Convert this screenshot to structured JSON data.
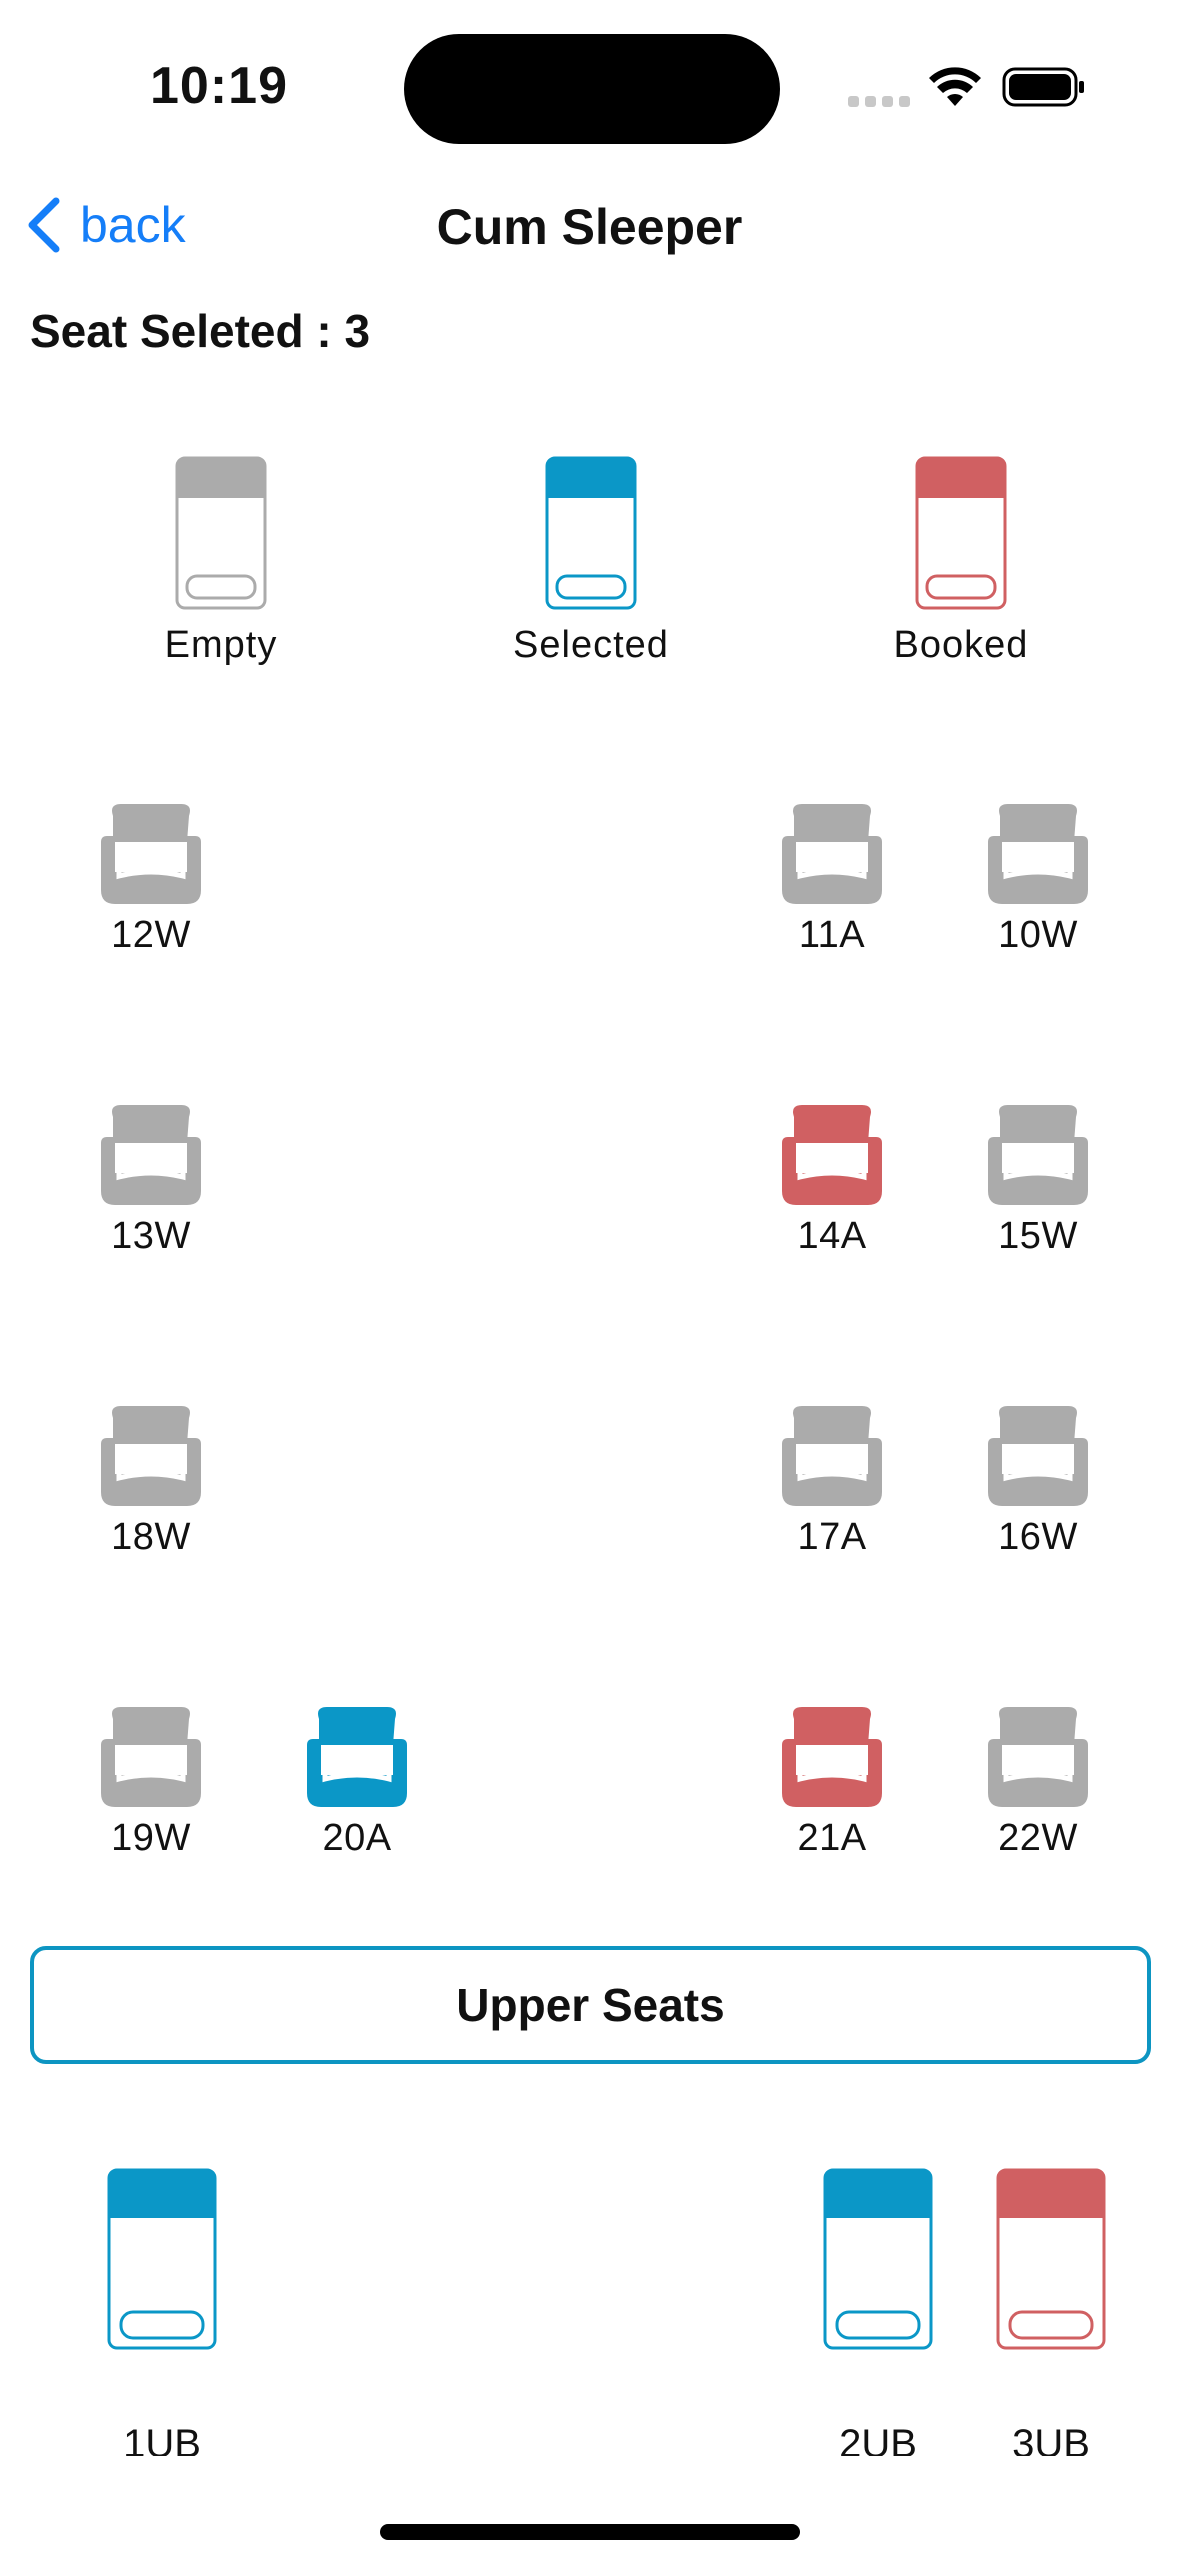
{
  "status": {
    "time": "10:19"
  },
  "nav": {
    "back_label": "back",
    "title": "Cum Sleeper"
  },
  "seat_count_text": "Seat Seleted : 3",
  "colors": {
    "empty": "#ababab",
    "selected": "#0b97c7",
    "booked": "#d06062",
    "accent": "#157ef8"
  },
  "legend": [
    {
      "label": "Empty",
      "state": "empty"
    },
    {
      "label": "Selected",
      "state": "selected"
    },
    {
      "label": "Booked",
      "state": "booked"
    }
  ],
  "lower_seats": [
    {
      "label": "12W",
      "state": "empty"
    },
    {
      "label": "11A",
      "state": "empty"
    },
    {
      "label": "10W",
      "state": "empty"
    },
    {
      "label": "13W",
      "state": "empty"
    },
    {
      "label": "14A",
      "state": "booked"
    },
    {
      "label": "15W",
      "state": "empty"
    },
    {
      "label": "18W",
      "state": "empty"
    },
    {
      "label": "17A",
      "state": "empty"
    },
    {
      "label": "16W",
      "state": "empty"
    },
    {
      "label": "19W",
      "state": "empty"
    },
    {
      "label": "20A",
      "state": "selected"
    },
    {
      "label": "21A",
      "state": "booked"
    },
    {
      "label": "22W",
      "state": "empty"
    }
  ],
  "upper_button_label": "Upper Seats",
  "upper_seats": [
    {
      "label": "1UB",
      "state": "selected"
    },
    {
      "label": "2UB",
      "state": "selected"
    },
    {
      "label": "3UB",
      "state": "booked"
    }
  ]
}
